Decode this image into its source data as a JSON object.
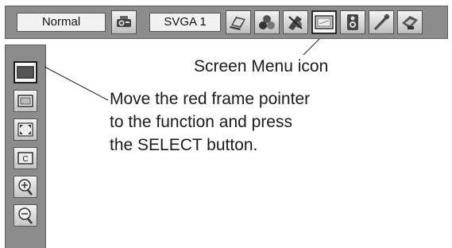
{
  "menubar": {
    "mode_label": "Normal",
    "resolution_label": "SVGA 1",
    "icons": [
      "projector-icon",
      "laptop-icon",
      "color-circles-icon",
      "image-adjust-icon",
      "screen-menu-icon",
      "speaker-icon",
      "tools-icon",
      "setting-icon"
    ],
    "selected_icon": "screen-menu-icon"
  },
  "sidebar": {
    "icons": [
      "normal-screen-icon",
      "true-screen-icon",
      "wide-screen-icon",
      "custom-screen-icon",
      "digital-zoom-plus-icon",
      "digital-zoom-minus-icon"
    ],
    "selected_icon": "normal-screen-icon"
  },
  "annotations": {
    "screen_menu": "Screen Menu icon",
    "pointer_line1": "Move the red frame pointer",
    "pointer_line2": "to the function and press",
    "pointer_line3": "the SELECT button."
  },
  "colors": {
    "toolbar_bg": "#8c8c8c",
    "tile_bg": "#e6e6e6",
    "text": "#1a1a1a"
  }
}
